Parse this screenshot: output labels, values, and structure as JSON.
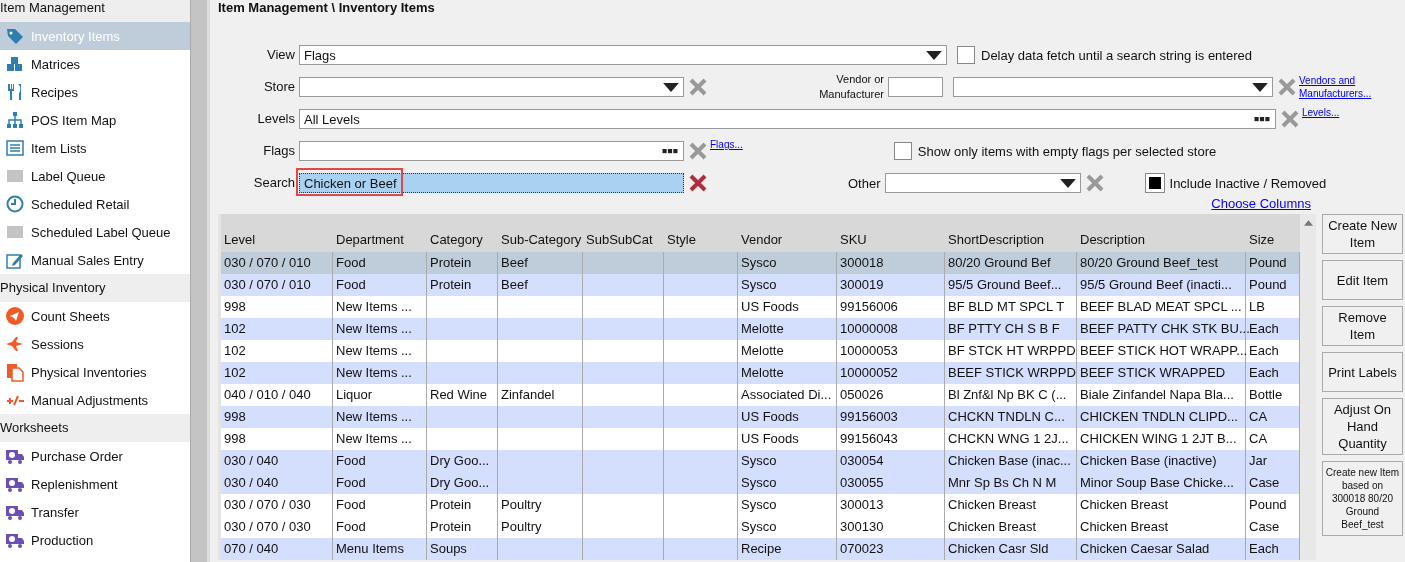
{
  "sidebar": {
    "sections": [
      {
        "title": "Item Management",
        "items": [
          {
            "label": "Inventory Items",
            "selected": true
          },
          {
            "label": "Matrices",
            "selected": false
          },
          {
            "label": "Recipes",
            "selected": false
          },
          {
            "label": "POS Item Map",
            "selected": false
          },
          {
            "label": "Item Lists",
            "selected": false
          },
          {
            "label": "Label Queue",
            "selected": false
          },
          {
            "label": "Scheduled Retail",
            "selected": false
          },
          {
            "label": "Scheduled Label Queue",
            "selected": false
          },
          {
            "label": "Manual Sales Entry",
            "selected": false
          }
        ]
      },
      {
        "title": "Physical Inventory",
        "items": [
          {
            "label": "Count Sheets",
            "selected": false
          },
          {
            "label": "Sessions",
            "selected": false
          },
          {
            "label": "Physical Inventories",
            "selected": false
          },
          {
            "label": "Manual Adjustments",
            "selected": false
          }
        ]
      },
      {
        "title": "Worksheets",
        "items": [
          {
            "label": "Purchase Order",
            "selected": false
          },
          {
            "label": "Replenishment",
            "selected": false
          },
          {
            "label": "Transfer",
            "selected": false
          },
          {
            "label": "Production",
            "selected": false
          }
        ]
      }
    ]
  },
  "breadcrumb": "Item Management \\ Inventory Items",
  "filters": {
    "view": {
      "label": "View",
      "value": "Flags"
    },
    "delay_fetch": {
      "label": "Delay data fetch until a search string is entered",
      "checked": false
    },
    "store": {
      "label": "Store",
      "clear_active": false
    },
    "vendor": {
      "label": "Vendor or Manufacturer",
      "clear_active": false,
      "link": "Vendors and Manufacturers..."
    },
    "levels": {
      "label": "Levels",
      "value": "All Levels",
      "clear_active": false,
      "link": "Levels..."
    },
    "flags": {
      "label": "Flags",
      "clear_active": false,
      "link": "Flags..."
    },
    "empty_flags": {
      "label": "Show only items with empty flags per selected store",
      "checked": false
    },
    "search": {
      "label": "Search",
      "value": "Chicken or Beef",
      "clear_active": true
    },
    "other": {
      "label": "Other",
      "clear_active": false
    },
    "include_inactive": {
      "label": "Include Inactive / Removed",
      "checked": true
    },
    "choose_columns": "Choose Columns"
  },
  "table": {
    "columns": [
      "Level",
      "Department",
      "Category",
      "Sub-Category",
      "SubSubCat",
      "Style",
      "Vendor",
      "SKU",
      "ShortDescription",
      "Description",
      "Size"
    ],
    "rows": [
      {
        "selected": true,
        "cells": [
          "030 / 070 / 010",
          "Food",
          "Protein",
          "Beef",
          "",
          "",
          "Sysco",
          "300018",
          "80/20 Ground Bef",
          "80/20 Ground Beef_test",
          "Pound"
        ]
      },
      {
        "selected": false,
        "shaded": true,
        "cells": [
          "030 / 070 / 010",
          "Food",
          "Protein",
          "Beef",
          "",
          "",
          "Sysco",
          "300019",
          "95/5 Ground Beef...",
          "95/5 Ground Beef (inacti...",
          "Pound"
        ]
      },
      {
        "selected": false,
        "shaded": false,
        "cells": [
          "998",
          "New Items ...",
          "",
          "",
          "",
          "",
          "US Foods",
          "99156006",
          "BF BLD MT SPCL T",
          "BEEF  BLAD MEAT SPCL ...",
          "LB"
        ]
      },
      {
        "selected": false,
        "shaded": true,
        "cells": [
          "102",
          "New Items ...",
          "",
          "",
          "",
          "",
          "Melotte",
          "10000008",
          "BF PTTY CH S B F",
          "BEEF PATTY CHK STK BU...",
          "Each"
        ]
      },
      {
        "selected": false,
        "shaded": false,
        "cells": [
          "102",
          "New Items ...",
          "",
          "",
          "",
          "",
          "Melotte",
          "10000053",
          "BF STCK HT WRPPD",
          "BEEF STICK HOT WRAPP...",
          "Each"
        ]
      },
      {
        "selected": false,
        "shaded": true,
        "cells": [
          "102",
          "New Items ...",
          "",
          "",
          "",
          "",
          "Melotte",
          "10000052",
          "BEEF STICK WRPPD",
          "BEEF STICK WRAPPED",
          "Each"
        ]
      },
      {
        "selected": false,
        "shaded": false,
        "cells": [
          "040 / 010 / 040",
          "Liquor",
          "Red Wine",
          "Zinfandel",
          "",
          "",
          "Associated Di...",
          "050026",
          "Bl Znf&l Np BK C (...",
          "Biale Zinfandel Napa Bla...",
          "Bottle"
        ]
      },
      {
        "selected": false,
        "shaded": true,
        "cells": [
          "998",
          "New Items ...",
          "",
          "",
          "",
          "",
          "US Foods",
          "99156003",
          "CHCKN TNDLN C...",
          "CHICKEN  TNDLN CLIPD...",
          "CA"
        ]
      },
      {
        "selected": false,
        "shaded": false,
        "cells": [
          "998",
          "New Items ...",
          "",
          "",
          "",
          "",
          "US Foods",
          "99156043",
          "CHCKN WNG 1 2J...",
          "CHICKEN  WING 1 2JT B...",
          "CA"
        ]
      },
      {
        "selected": false,
        "shaded": true,
        "cells": [
          "030 / 040",
          "Food",
          "Dry Goo...",
          "",
          "",
          "",
          "Sysco",
          "030054",
          "Chicken Base (inac...",
          "Chicken Base (inactive)",
          "Jar"
        ]
      },
      {
        "selected": false,
        "shaded": true,
        "cells": [
          "030 / 040",
          "Food",
          "Dry Goo...",
          "",
          "",
          "",
          "Sysco",
          "030055",
          "Mnr Sp Bs Ch N M",
          "Minor Soup Base Chicke...",
          "Case"
        ]
      },
      {
        "selected": false,
        "shaded": false,
        "cells": [
          "030 / 070 / 030",
          "Food",
          "Protein",
          "Poultry",
          "",
          "",
          "Sysco",
          "300013",
          "Chicken Breast",
          "Chicken Breast",
          "Pound"
        ]
      },
      {
        "selected": false,
        "shaded": false,
        "cells": [
          "030 / 070 / 030",
          "Food",
          "Protein",
          "Poultry",
          "",
          "",
          "Sysco",
          "300130",
          "Chicken Breast",
          "Chicken Breast",
          "Case"
        ]
      },
      {
        "selected": false,
        "shaded": true,
        "cells": [
          "070 / 040",
          "Menu Items",
          "Soups",
          "",
          "",
          "",
          "Recipe",
          "070023",
          "Chicken Casr Sld",
          "Chicken Caesar Salad",
          "Each"
        ]
      }
    ]
  },
  "actions": [
    {
      "label": "Create New Item",
      "kind": "normal"
    },
    {
      "label": "Edit Item",
      "kind": "normal"
    },
    {
      "label": "Remove Item",
      "kind": "normal"
    },
    {
      "label": "Print Labels",
      "kind": "normal"
    },
    {
      "label": "Adjust On Hand Quantity",
      "kind": "normal"
    },
    {
      "label": "Create new Item based on 300018 80/20 Ground Beef_test",
      "kind": "compact"
    }
  ]
}
